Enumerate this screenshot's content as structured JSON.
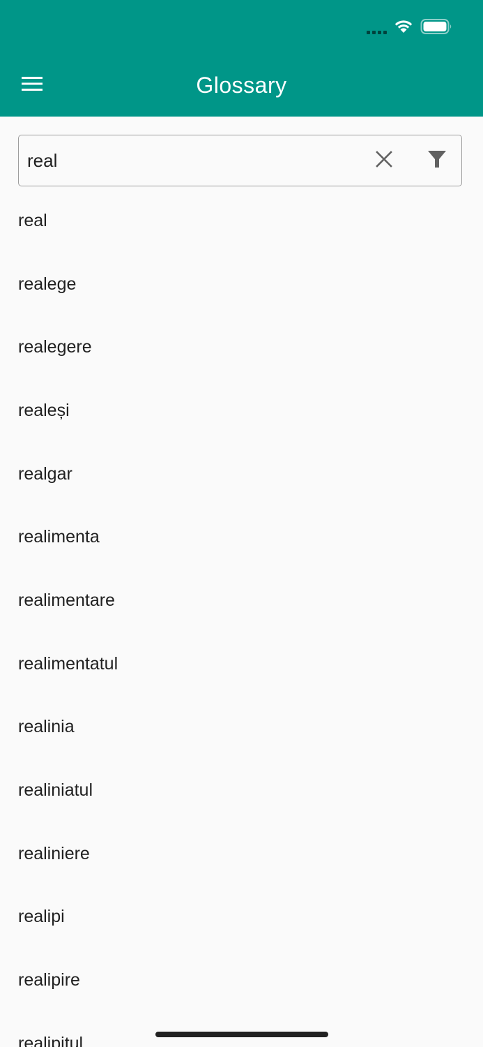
{
  "app_bar": {
    "title": "Glossary",
    "background_color": "#009688",
    "menu_icon": "hamburger-menu-icon"
  },
  "status_bar": {
    "icons": [
      "signal-icon",
      "wifi-icon",
      "battery-icon"
    ]
  },
  "search": {
    "value": "real",
    "clear_icon": "close-icon",
    "filter_icon": "filter-icon"
  },
  "words": [
    "real",
    "realege",
    "realegere",
    "realeși",
    "realgar",
    "realimenta",
    "realimentare",
    "realimentatul",
    "realinia",
    "realiniatul",
    "realiniere",
    "realipi",
    "realipire",
    "realipitul"
  ]
}
